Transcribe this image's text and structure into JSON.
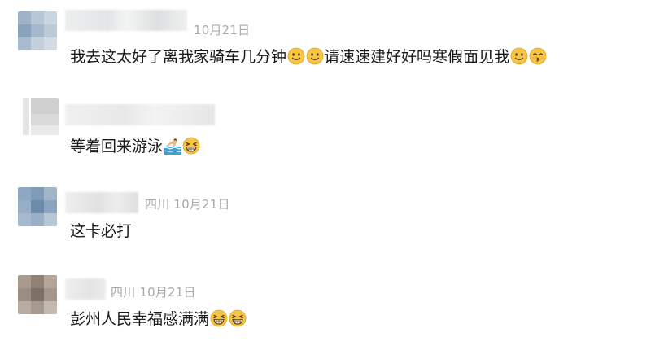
{
  "comments": [
    {
      "meta": "10月21日",
      "segments": [
        {
          "t": "text",
          "v": "我去这太好了离我家骑车几分钟"
        },
        {
          "t": "emoji",
          "name": "slightly-smiling-face-icon"
        },
        {
          "t": "emoji",
          "name": "slightly-smiling-face-icon"
        },
        {
          "t": "text",
          "v": "请速速建好好吗寒假面见我"
        },
        {
          "t": "emoji",
          "name": "slightly-smiling-face-icon"
        },
        {
          "t": "emoji",
          "name": "kissing-face-icon"
        }
      ]
    },
    {
      "meta": "",
      "segments": [
        {
          "t": "text",
          "v": "等着回来游泳"
        },
        {
          "t": "emoji",
          "name": "swimmer-icon"
        },
        {
          "t": "emoji",
          "name": "grinning-squinting-face-icon"
        }
      ]
    },
    {
      "meta": "四川 10月21日",
      "segments": [
        {
          "t": "text",
          "v": "这卡必打"
        }
      ]
    },
    {
      "meta": "四川 10月21日",
      "segments": [
        {
          "t": "text",
          "v": "彭州人民幸福感满满"
        },
        {
          "t": "emoji",
          "name": "grinning-squinting-face-icon"
        },
        {
          "t": "emoji",
          "name": "grinning-squinting-face-icon"
        }
      ]
    }
  ],
  "colors": {
    "meta": "#a9a9a9",
    "text": "#1a1a1a",
    "emoji_face": "#f6c544"
  }
}
